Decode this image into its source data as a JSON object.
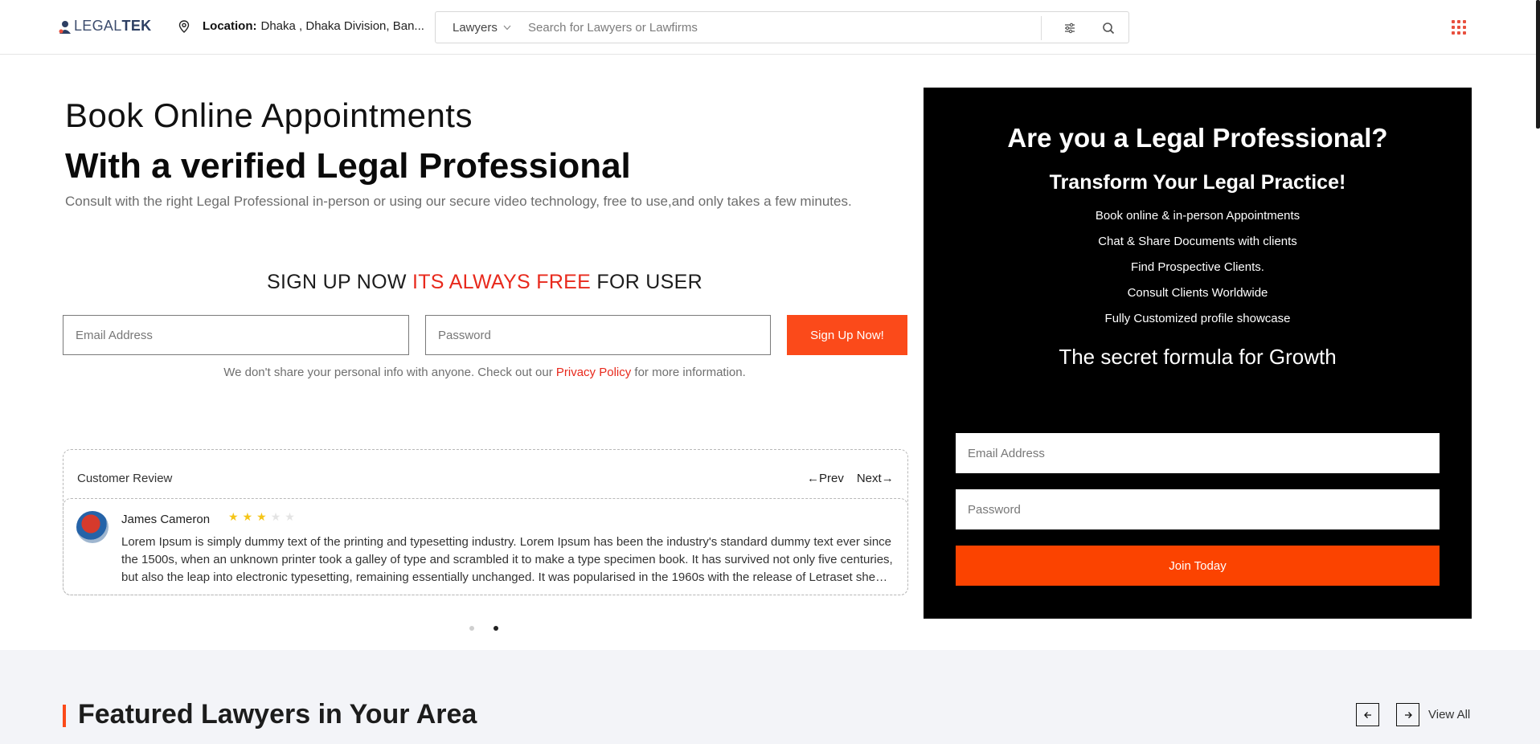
{
  "header": {
    "logo_text_a": "LEGAL",
    "logo_text_b": "TEK",
    "location_label": "Location:",
    "location_value": "Dhaka , Dhaka Division, Ban...",
    "search_type": "Lawyers",
    "search_placeholder": "Search for Lawyers or Lawfirms",
    "brand_color": "#e8503e"
  },
  "hero": {
    "line1": "Book Online Appointments",
    "line2": "With a verified Legal Professional",
    "subtitle": "Consult with the right Legal Professional in-person or using our secure video technology, free to use,and only takes a few minutes."
  },
  "signup": {
    "title_a": "SIGN UP NOW ",
    "title_accent": "ITS ALWAYS FREE",
    "title_b": " FOR USER",
    "email_placeholder": "Email Address",
    "password_placeholder": "Password",
    "button_label": "Sign Up Now!",
    "privacy_a": "We don't share your personal info with anyone. Check out our ",
    "privacy_link": "Privacy Policy",
    "privacy_b": " for more information.",
    "accent_color": "#e8291c",
    "button_color": "#fb4a1a"
  },
  "review": {
    "heading": "Customer Review",
    "prev_label": "Prev",
    "next_label": "Next",
    "reviewer_name": "James Cameron",
    "rating": 3,
    "rating_max": 5,
    "text": "Lorem Ipsum is simply dummy text of the printing and typesetting industry. Lorem Ipsum has been the industry's standard dummy text ever since the 1500s, when an unknown printer took a galley of type and scrambled it to make a type specimen book. It has survived not only five centuries, but also the leap into electronic typesetting, remaining essentially unchanged. It was popularised in the 1960s with the release of Letraset sheets containing Lorem Ipsum passages.",
    "slide_count": 2,
    "active_slide": 2
  },
  "promo": {
    "title": "Are you a Legal Professional?",
    "subtitle": "Transform Your Legal Practice!",
    "features": [
      "Book online & in-person Appointments",
      "Chat & Share Documents with clients",
      "Find Prospective Clients.",
      "Consult Clients Worldwide",
      "Fully Customized profile showcase"
    ],
    "growth": "The secret formula for Growth",
    "email_placeholder": "Email Address",
    "password_placeholder": "Password",
    "button_label": "Join Today",
    "button_color": "#fb4300"
  },
  "featured": {
    "title": "Featured Lawyers in Your Area",
    "view_all": "View All"
  },
  "icons": {
    "logo": "lawyer-logo-icon",
    "location": "map-pin-icon",
    "dropdown": "chevron-down-icon",
    "filter": "sliders-icon",
    "search": "search-icon",
    "apps": "grid-apps-icon",
    "prev": "arrow-left-icon",
    "next": "arrow-right-icon",
    "star": "star-icon"
  }
}
